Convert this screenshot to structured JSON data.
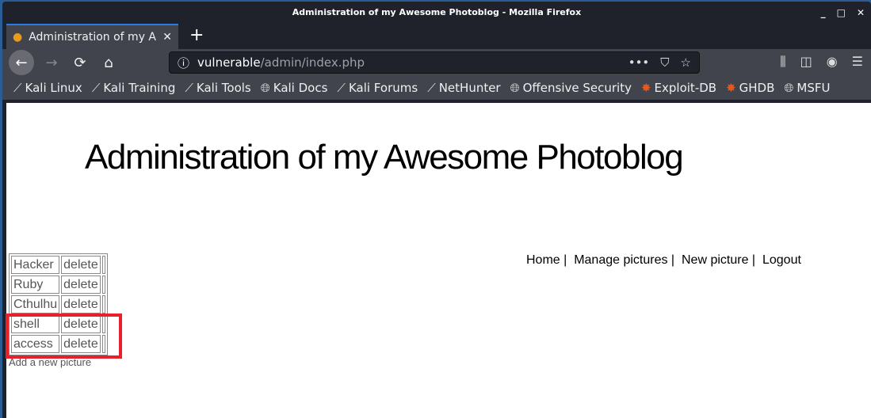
{
  "window": {
    "title": "Administration of my Awesome Photoblog - Mozilla Firefox"
  },
  "tab": {
    "label": "Administration of my Awesome Photoblog"
  },
  "url": {
    "host": "vulnerable",
    "path": "/admin/index.php"
  },
  "bookmarks": [
    {
      "label": "Kali Linux",
      "icon": "kali-dragon-icon"
    },
    {
      "label": "Kali Training",
      "icon": "kali-dragon-icon"
    },
    {
      "label": "Kali Tools",
      "icon": "kali-dragon-icon"
    },
    {
      "label": "Kali Docs",
      "icon": "globe-icon"
    },
    {
      "label": "Kali Forums",
      "icon": "kali-dragon-icon"
    },
    {
      "label": "NetHunter",
      "icon": "kali-dragon-icon"
    },
    {
      "label": "Offensive Security",
      "icon": "globe-icon"
    },
    {
      "label": "Exploit-DB",
      "icon": "exploitdb-icon"
    },
    {
      "label": "GHDB",
      "icon": "exploitdb-icon"
    },
    {
      "label": "MSFU",
      "icon": "globe-icon"
    }
  ],
  "page": {
    "heading": "Administration of my Awesome Photoblog",
    "menu": [
      "Home",
      "Manage pictures",
      "New picture",
      "Logout"
    ],
    "pictures": [
      {
        "name": "Hacker",
        "action": "delete"
      },
      {
        "name": "Ruby",
        "action": "delete"
      },
      {
        "name": "Cthulhu",
        "action": "delete"
      },
      {
        "name": "shell",
        "action": "delete"
      },
      {
        "name": "access",
        "action": "delete"
      }
    ],
    "add_link": "Add a new picture"
  },
  "colors": {
    "highlight": "#e8202a",
    "tab_accent": "#2a7ce5"
  }
}
